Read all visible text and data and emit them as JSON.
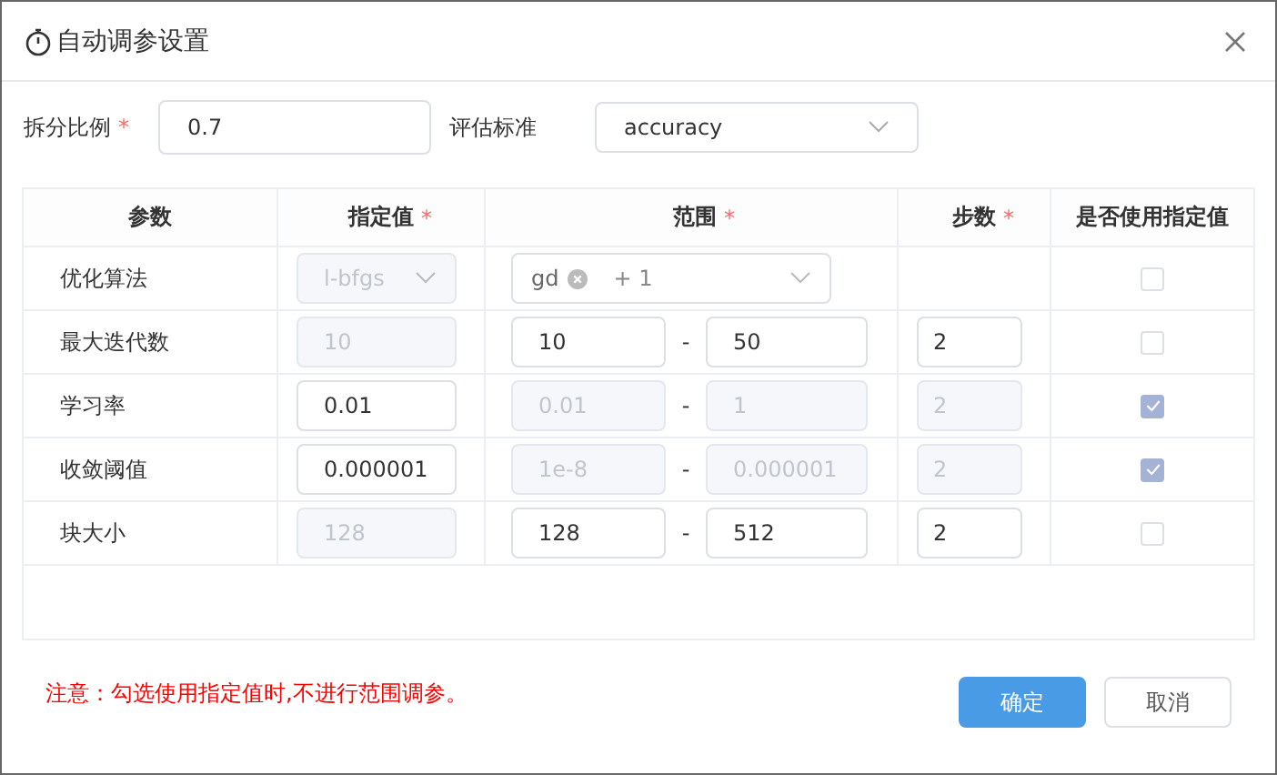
{
  "dialog": {
    "title": "自动调参设置"
  },
  "form": {
    "split_label": "拆分比例",
    "split_value": "0.7",
    "metric_label": "评估标准",
    "metric_value": "accuracy"
  },
  "table": {
    "columns": [
      {
        "label": "参数",
        "required": false
      },
      {
        "label": "指定值",
        "required": true
      },
      {
        "label": "范围",
        "required": true
      },
      {
        "label": "步数",
        "required": true
      },
      {
        "label": "是否使用指定值",
        "required": false
      }
    ],
    "rows": [
      {
        "name": "优化算法",
        "kind": "select",
        "value": "l-bfgs",
        "range_tags": [
          "gd"
        ],
        "range_more": "+ 1",
        "checked": false
      },
      {
        "name": "最大迭代数",
        "kind": "input",
        "value": "10",
        "range_min": "10",
        "range_max": "50",
        "step": "2",
        "checked": false
      },
      {
        "name": "学习率",
        "kind": "input",
        "value": "0.01",
        "range_min": "0.01",
        "range_max": "1",
        "step": "2",
        "checked": true
      },
      {
        "name": "收敛阈值",
        "kind": "input",
        "value": "0.000001",
        "range_min": "1e-8",
        "range_max": "0.000001",
        "step": "2",
        "checked": true
      },
      {
        "name": "块大小",
        "kind": "input",
        "value": "128",
        "range_min": "128",
        "range_max": "512",
        "step": "2",
        "checked": false
      }
    ]
  },
  "range_separator": "-",
  "required_mark": "*",
  "note": "注意：勾选使用指定值时,不进行范围调参。",
  "buttons": {
    "confirm": "确定",
    "cancel": "取消"
  }
}
